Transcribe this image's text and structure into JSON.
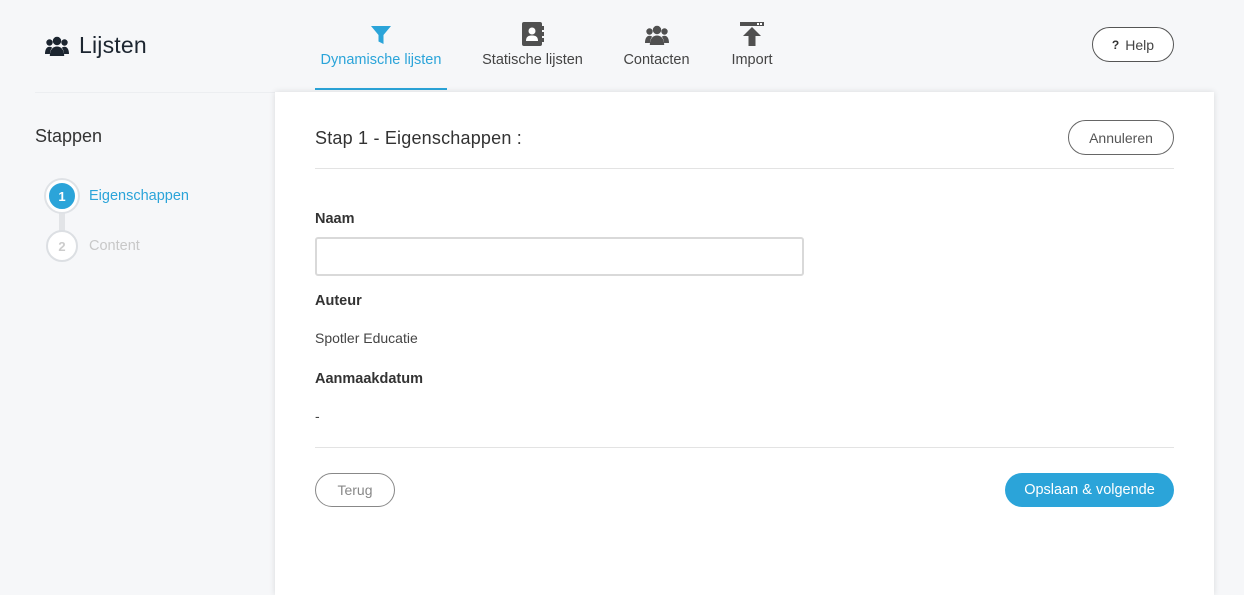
{
  "app": {
    "title": "Lijsten",
    "icon": "users-icon"
  },
  "nav": {
    "items": [
      {
        "label": "Dynamische lijsten",
        "icon": "filter-icon",
        "active": true
      },
      {
        "label": "Statische lijsten",
        "icon": "address-book-icon",
        "active": false
      },
      {
        "label": "Contacten",
        "icon": "users-icon",
        "active": false
      },
      {
        "label": "Import",
        "icon": "upload-icon",
        "active": false
      }
    ]
  },
  "help": {
    "label": "Help",
    "icon": "question-icon"
  },
  "sidebar": {
    "title": "Stappen",
    "steps": [
      {
        "number": "1",
        "label": "Eigenschappen",
        "state": "active"
      },
      {
        "number": "2",
        "label": "Content",
        "state": "inactive"
      }
    ]
  },
  "form": {
    "title": "Stap 1 - Eigenschappen :",
    "cancel_label": "Annuleren",
    "name_label": "Naam",
    "name_value": "",
    "author_label": "Auteur",
    "author_value": "Spotler Educatie",
    "created_label": "Aanmaakdatum",
    "created_value": "-",
    "back_label": "Terug",
    "submit_label": "Opslaan & volgende"
  },
  "colors": {
    "accent": "#2ba4d9",
    "text": "#333333",
    "background": "#f6f7f9"
  }
}
